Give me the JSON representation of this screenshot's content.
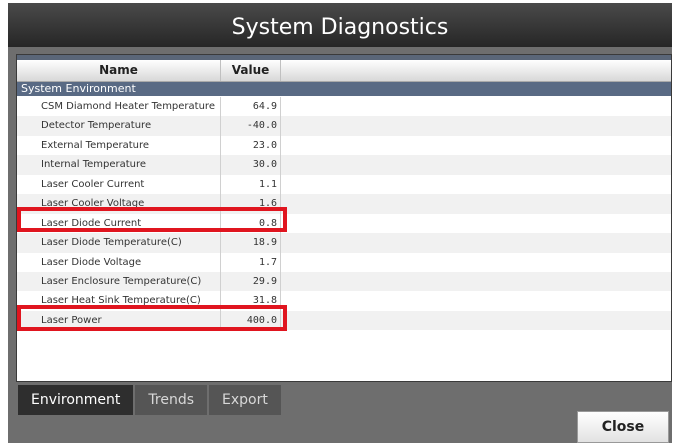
{
  "window": {
    "title": "System Diagnostics"
  },
  "table": {
    "columns": {
      "name": "Name",
      "value": "Value"
    },
    "group": "System Environment",
    "rows": [
      {
        "name": "CSM Diamond Heater Temperature",
        "value": "64.9"
      },
      {
        "name": "Detector Temperature",
        "value": "-40.0"
      },
      {
        "name": "External Temperature",
        "value": "23.0"
      },
      {
        "name": "Internal Temperature",
        "value": "30.0"
      },
      {
        "name": "Laser Cooler Current",
        "value": "1.1"
      },
      {
        "name": "Laser Cooler Voltage",
        "value": "1.6"
      },
      {
        "name": "Laser Diode Current",
        "value": "0.8"
      },
      {
        "name": "Laser Diode Temperature(C)",
        "value": "18.9"
      },
      {
        "name": "Laser Diode Voltage",
        "value": "1.7"
      },
      {
        "name": "Laser Enclosure Temperature(C)",
        "value": "29.9"
      },
      {
        "name": "Laser Heat Sink Temperature(C)",
        "value": "31.8"
      },
      {
        "name": "Laser Power",
        "value": "400.0"
      }
    ]
  },
  "tabs": [
    {
      "label": "Environment",
      "active": true
    },
    {
      "label": "Trends",
      "active": false
    },
    {
      "label": "Export",
      "active": false
    }
  ],
  "buttons": {
    "close": "Close"
  },
  "colors": {
    "highlight": "#e0151f",
    "group_header": "#596a84"
  }
}
